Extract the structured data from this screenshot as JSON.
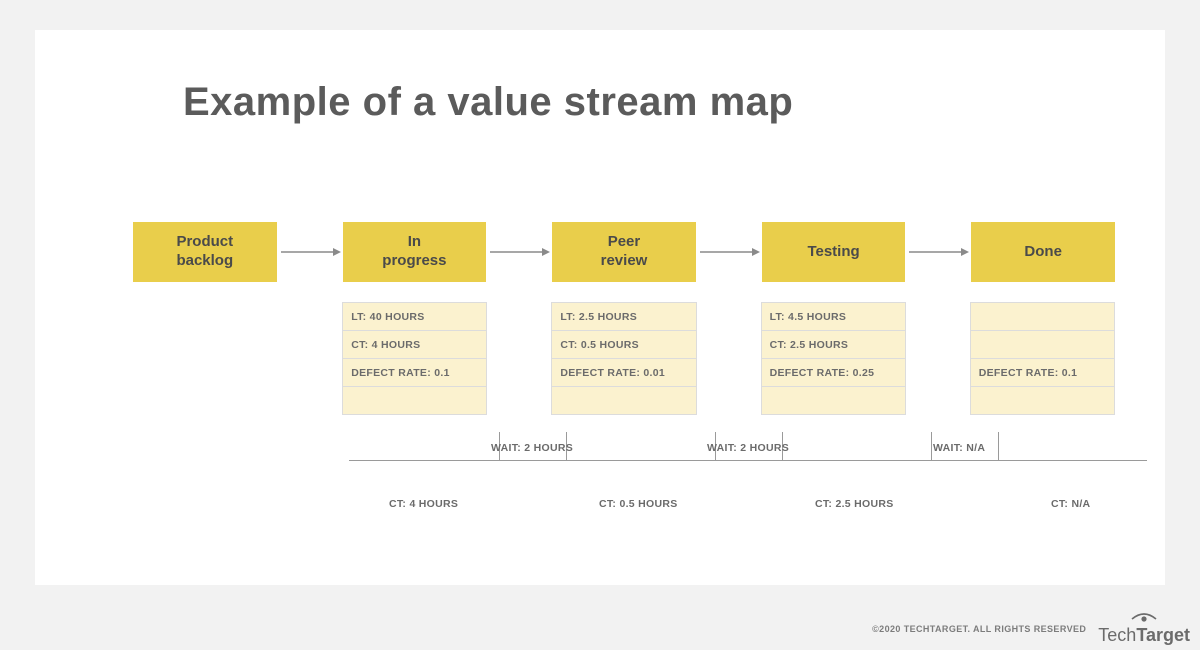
{
  "title": "Example of a value stream map",
  "stages": [
    {
      "label": "Product\nbacklog",
      "lt": "",
      "ct": "",
      "defect": ""
    },
    {
      "label": "In\nprogress",
      "lt": "LT: 40 HOURS",
      "ct": "CT: 4 HOURS",
      "defect": "DEFECT RATE: 0.1"
    },
    {
      "label": "Peer\nreview",
      "lt": "LT: 2.5 HOURS",
      "ct": "CT: 0.5 HOURS",
      "defect": "DEFECT RATE: 0.01"
    },
    {
      "label": "Testing",
      "lt": "LT: 4.5 HOURS",
      "ct": "CT: 2.5 HOURS",
      "defect": "DEFECT RATE: 0.25"
    },
    {
      "label": "Done",
      "lt": "",
      "ct": "",
      "defect": "DEFECT RATE: 0.1"
    }
  ],
  "timeline": {
    "ct": [
      "CT: 4 HOURS",
      "CT: 0.5 HOURS",
      "CT: 2.5 HOURS",
      "CT: N/A"
    ],
    "wait": [
      "WAIT: 2 HOURS",
      "WAIT: 2 HOURS",
      "WAIT: N/A"
    ]
  },
  "footer": {
    "copyright": "©2020 TECHTARGET. ALL RIGHTS RESERVED",
    "brand_light": "Tech",
    "brand_bold": "Target"
  }
}
